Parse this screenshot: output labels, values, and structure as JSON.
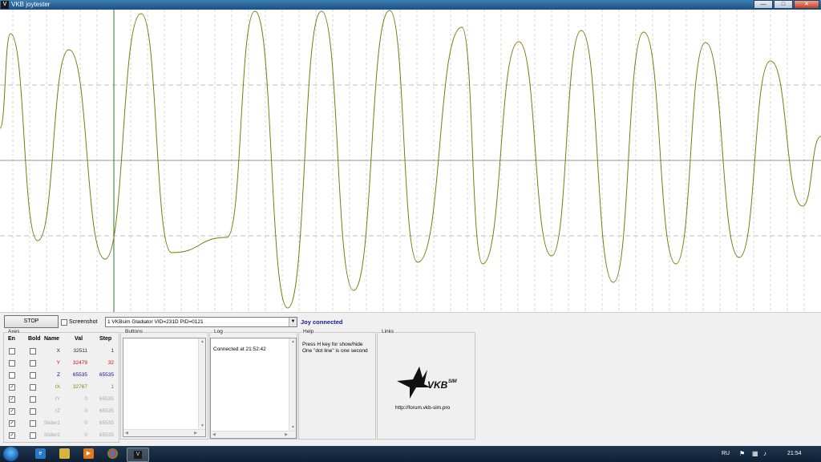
{
  "window": {
    "title": "VKB joytester",
    "minimize": "—",
    "maximize": "□",
    "close": "✕",
    "app_icon": "V"
  },
  "toolbar": {
    "stop_label": "STOP",
    "screenshot_label": "Screenshot",
    "device_value": "1 VKBsim Gladiator  VID=231D PID=0121",
    "status_text": "Joy connected",
    "status_color": "#1a1a8c"
  },
  "axes": {
    "legend": "Axes",
    "headers": {
      "en": "En",
      "bold": "Bold",
      "name": "Name",
      "val": "Val",
      "step": "Step"
    },
    "rows": [
      {
        "en": false,
        "bold": false,
        "name": "X",
        "val": "32511",
        "step": "1",
        "color": "#2b2b2b"
      },
      {
        "en": false,
        "bold": false,
        "name": "Y",
        "val": "32479",
        "step": "32",
        "color": "#d01010"
      },
      {
        "en": false,
        "bold": false,
        "name": "Z",
        "val": "65535",
        "step": "65535",
        "color": "#101090"
      },
      {
        "en": true,
        "bold": false,
        "name": "rX",
        "val": "32767",
        "step": "1",
        "color": "#7a8a10"
      },
      {
        "en": true,
        "bold": false,
        "name": "rY",
        "val": "0",
        "step": "65535",
        "color": "#a8a8a8"
      },
      {
        "en": true,
        "bold": false,
        "name": "rZ",
        "val": "0",
        "step": "65535",
        "color": "#a8a8a8"
      },
      {
        "en": true,
        "bold": false,
        "name": "Slider1",
        "val": "0",
        "step": "65535",
        "color": "#a8a8a8"
      },
      {
        "en": true,
        "bold": false,
        "name": "Slider2",
        "val": "0",
        "step": "65535",
        "color": "#a8a8a8"
      }
    ]
  },
  "buttons_group": {
    "legend": "Buttons"
  },
  "log": {
    "legend": "Log",
    "text": "Connected at 21:52:42"
  },
  "help": {
    "legend": "Help",
    "line1": "Press H key for show/hide",
    "line2": "One \"dot line\" is one second"
  },
  "links": {
    "legend": "Links",
    "logo_text": "VKB",
    "logo_sub": "SIM",
    "url": "http://forum.vkb-sim.pro"
  },
  "plot": {
    "trace_color": "#7a7a10",
    "cursor_color": "#2a7a2a"
  },
  "taskbar": {
    "lang": "RU",
    "clock": "21:54",
    "icons": [
      "ie-icon",
      "explorer-icon",
      "media-player-icon",
      "chrome-icon",
      "joytester-task-icon"
    ]
  }
}
